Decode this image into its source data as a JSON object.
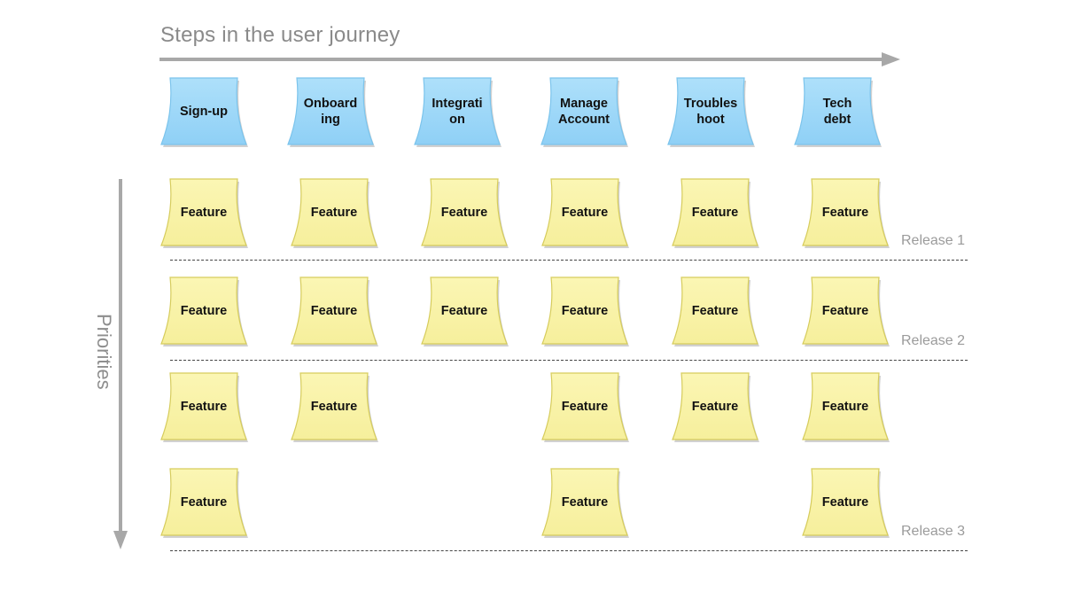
{
  "title": "Steps in the user journey",
  "vertical_axis_label": "Priorities",
  "colors": {
    "step_fill": "#aee0fa",
    "step_border": "#7cc4ec",
    "feature_fill": "#fbf6b4",
    "feature_border": "#d6cc5c",
    "arrow": "#a8a8a8"
  },
  "steps": [
    {
      "label": "Sign-up"
    },
    {
      "label": "Onboard\ning"
    },
    {
      "label": "Integrati\non"
    },
    {
      "label": "Manage\nAccount"
    },
    {
      "label": "Troubles\nhoot"
    },
    {
      "label": "Tech\ndebt"
    }
  ],
  "feature_label": "Feature",
  "rows": [
    {
      "cells": [
        true,
        true,
        true,
        true,
        true,
        true
      ]
    },
    {
      "cells": [
        true,
        true,
        true,
        true,
        true,
        true
      ]
    },
    {
      "cells": [
        true,
        true,
        false,
        true,
        true,
        true
      ]
    },
    {
      "cells": [
        true,
        false,
        false,
        true,
        false,
        true
      ]
    }
  ],
  "releases": [
    {
      "label": "Release 1"
    },
    {
      "label": "Release 2"
    },
    {
      "label": "Release 3"
    }
  ]
}
